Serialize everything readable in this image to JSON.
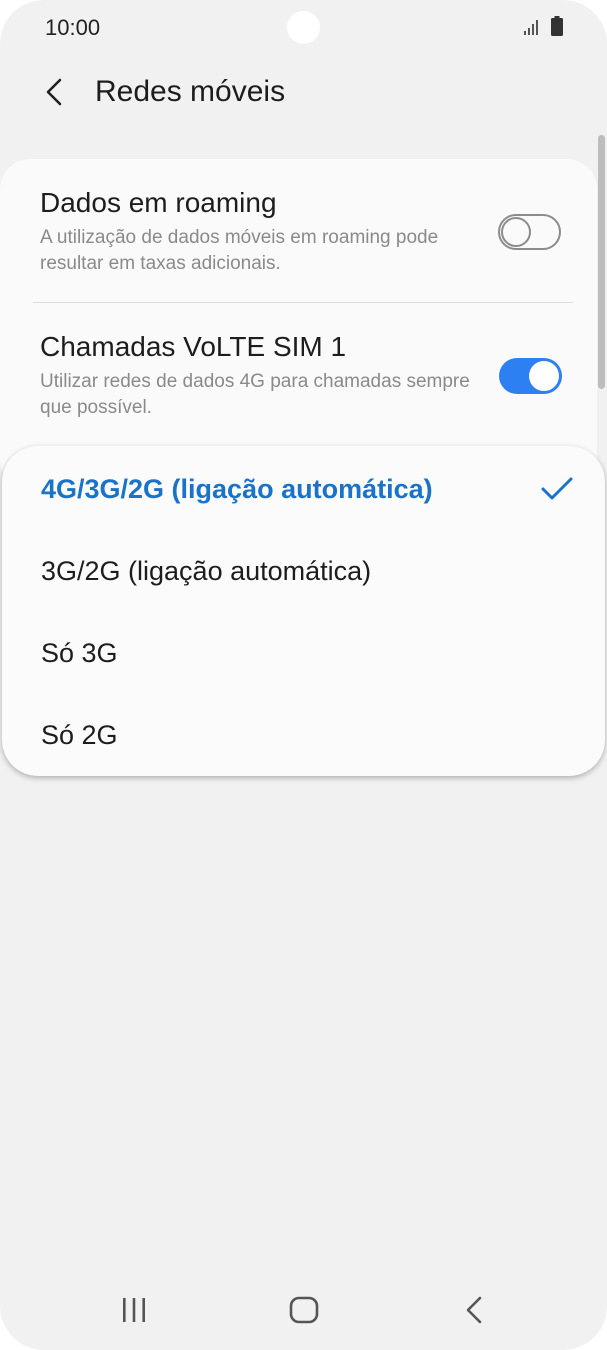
{
  "status_bar": {
    "time": "10:00",
    "icons": [
      "signal-icon",
      "battery-icon"
    ]
  },
  "header": {
    "title": "Redes móveis",
    "back_icon": "chevron-left-icon"
  },
  "settings": {
    "roaming": {
      "title": "Dados em roaming",
      "description": "A utilização de dados móveis em roaming pode resultar em taxas adicionais.",
      "enabled": false
    },
    "volte": {
      "title": "Chamadas VoLTE SIM 1",
      "description": "Utilizar redes de dados 4G para chamadas sempre que possível.",
      "enabled": true
    }
  },
  "network_mode_popup": {
    "options": [
      {
        "label": "4G/3G/2G (ligação automática)",
        "selected": true
      },
      {
        "label": "3G/2G (ligação automática)",
        "selected": false
      },
      {
        "label": "Só 3G",
        "selected": false
      },
      {
        "label": "Só 2G",
        "selected": false
      }
    ]
  },
  "nav_bar": {
    "items": [
      "recent-apps-icon",
      "home-icon",
      "back-icon"
    ]
  },
  "colors": {
    "accent": "#2e7ff1",
    "selected_text": "#1a73c8",
    "background": "#f1f1f1",
    "card": "#fafafa"
  }
}
